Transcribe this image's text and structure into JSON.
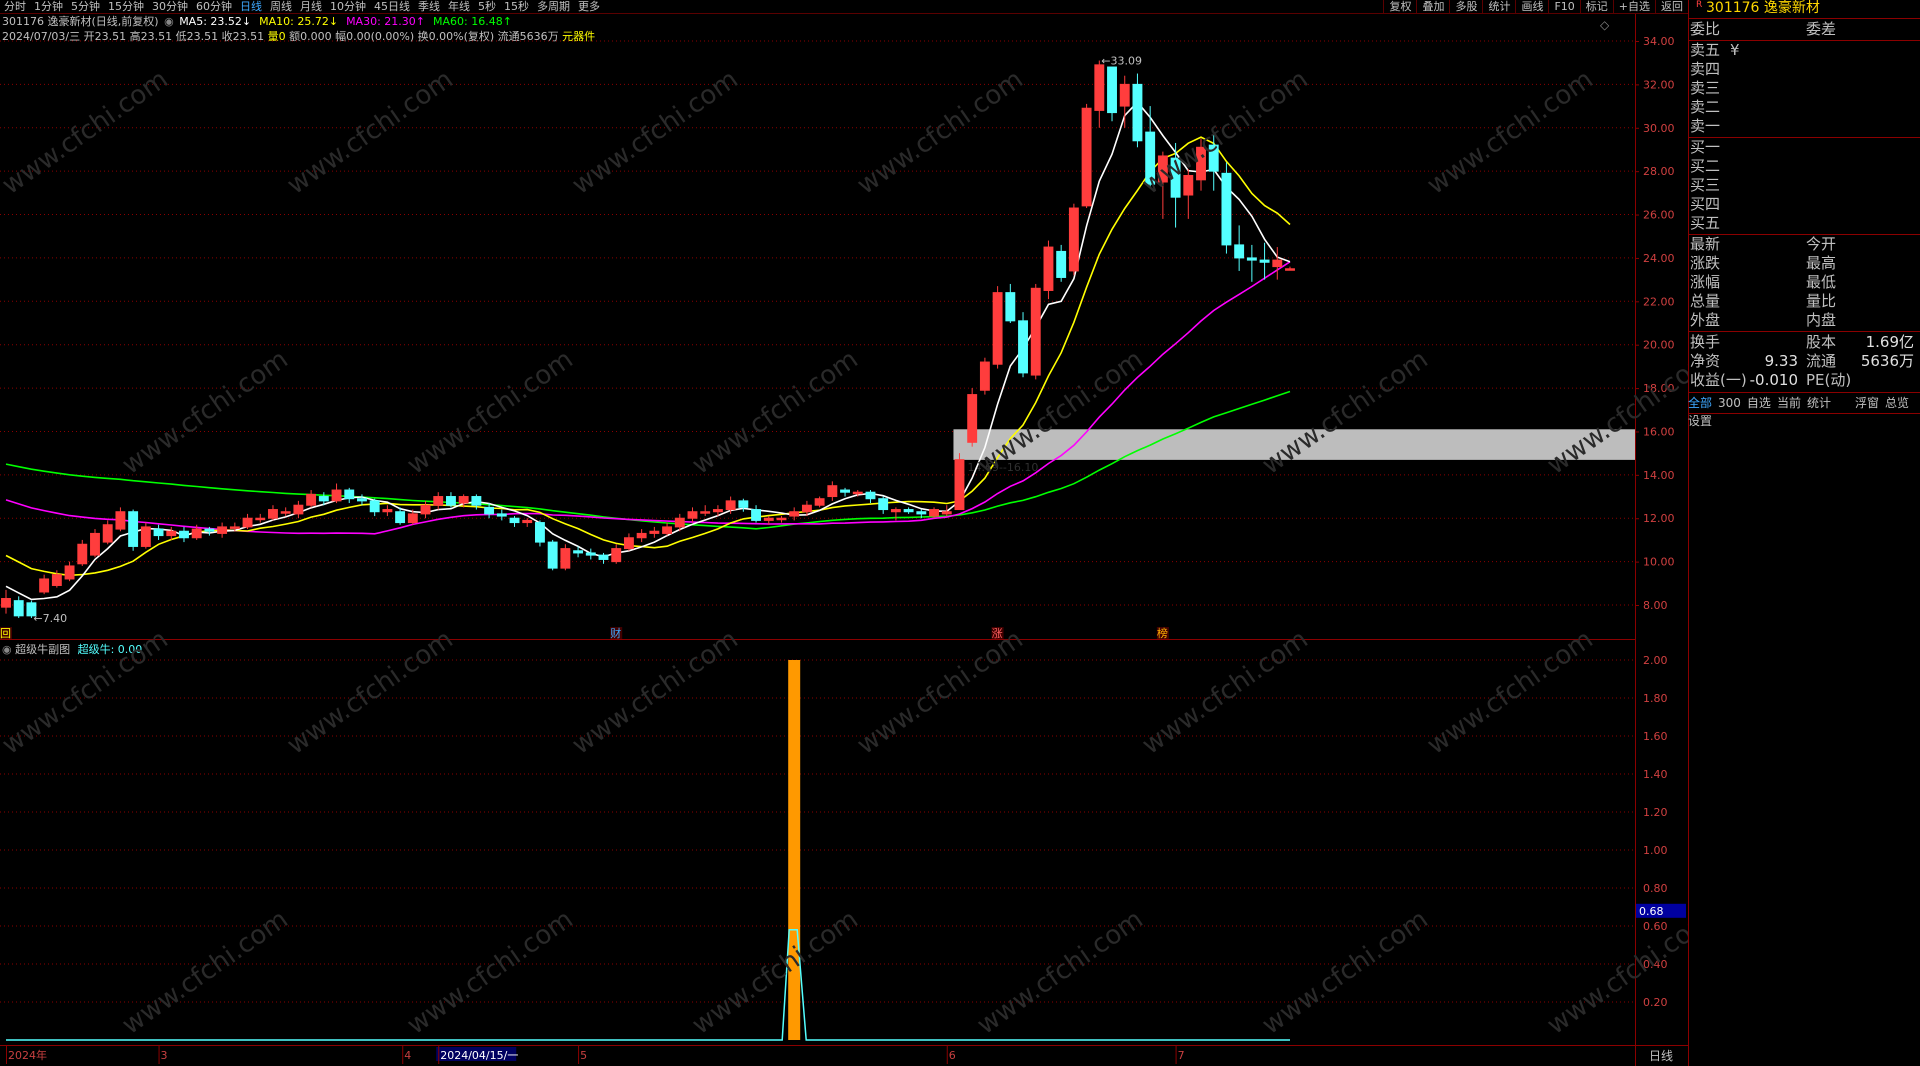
{
  "toolbar": {
    "periods": [
      "分时",
      "1分钟",
      "5分钟",
      "15分钟",
      "30分钟",
      "60分钟",
      "日线",
      "周线",
      "月线",
      "10分钟",
      "45日线",
      "季线",
      "年线",
      "5秒",
      "15秒",
      "多周期",
      "更多"
    ],
    "active": "日线",
    "right": [
      "复权",
      "叠加",
      "多股",
      "统计",
      "画线",
      "F10",
      "标记",
      "+自选",
      "返回"
    ]
  },
  "stock": {
    "code": "301176",
    "name": "逸豪新材",
    "header": "301176 逸豪新材(日线,前复权)",
    "corner_mark": "R"
  },
  "ma_legend": [
    {
      "label": "MA5: 23.52↓",
      "color": "#ffffff"
    },
    {
      "label": "MA10: 25.72↓",
      "color": "#ffff00"
    },
    {
      "label": "MA30: 21.30↑",
      "color": "#ff00ff"
    },
    {
      "label": "MA60: 16.48↑",
      "color": "#00ff00"
    }
  ],
  "quote_line": {
    "date": "2024/07/03/三",
    "open": "开23.51",
    "high": "高23.51",
    "low": "低23.51",
    "close": "收23.51",
    "vol": "量0",
    "amount": "额0.000",
    "change": "幅0.00(0.00%)",
    "turnover": "换0.00%(复权)",
    "float": "流通5636万",
    "tool": "元器件"
  },
  "indicator": {
    "name": "超级牛副图",
    "value_label": "超级牛: 0.00"
  },
  "price_axis": [
    "34.00",
    "32.00",
    "30.00",
    "28.00",
    "26.00",
    "24.00",
    "22.00",
    "20.00",
    "18.00",
    "16.00",
    "14.00",
    "12.00",
    "10.00",
    "8.00"
  ],
  "sub_axis": [
    "2.00",
    "1.80",
    "1.60",
    "1.40",
    "1.20",
    "1.00",
    "0.80",
    "0.60",
    "0.40",
    "0.20"
  ],
  "sub_marker": "0.68",
  "time_axis": {
    "labels": [
      "2024年",
      "3",
      "4",
      "2024/04/15/一",
      "5",
      "6",
      "7"
    ],
    "period": "日线"
  },
  "annotations": {
    "high": "33.09",
    "low": "7.40",
    "zone": "14.69--16.10",
    "events": [
      "回",
      "财",
      "涨",
      "榜"
    ]
  },
  "colors": {
    "up": "#ff3d3d",
    "down": "#54ffff",
    "ma5": "#ffffff",
    "ma10": "#ffff00",
    "ma30": "#ff00ff",
    "ma60": "#00ff00",
    "grid": "#8b0000",
    "bar": "#ff9900",
    "title": "#ffd700"
  },
  "panel": {
    "header": {
      "left": "委比",
      "right": "委差"
    },
    "sells": [
      "卖五",
      "卖四",
      "卖三",
      "卖二",
      "卖一"
    ],
    "buys": [
      "买一",
      "买二",
      "买三",
      "买四",
      "买五"
    ],
    "yen": "¥",
    "stats": [
      {
        "l": "最新",
        "m": "今开",
        "r": ""
      },
      {
        "l": "涨跌",
        "m": "最高",
        "r": ""
      },
      {
        "l": "涨幅",
        "m": "最低",
        "r": ""
      },
      {
        "l": "总量",
        "m": "量比",
        "r": ""
      },
      {
        "l": "外盘",
        "m": "内盘",
        "r": ""
      }
    ],
    "stats2": [
      {
        "l": "换手",
        "mv": "",
        "m": "股本",
        "r": "1.69亿"
      },
      {
        "l": "净资",
        "mv": "9.33",
        "m": "流通",
        "r": "5636万"
      },
      {
        "l": "收益(一)",
        "mv": "-0.010",
        "m": "PE(动)",
        "r": ""
      }
    ],
    "tabs": [
      "全部",
      "300",
      "自选",
      "当前",
      "统计",
      "浮窗",
      "总览",
      "设置"
    ]
  },
  "watermark": "www.cfchi.com",
  "chart_data": {
    "type": "candlestick",
    "candles": [
      [
        7.9,
        8.3,
        7.6,
        8.7
      ],
      [
        8.2,
        7.5,
        7.4,
        8.4
      ],
      [
        8.1,
        7.5,
        7.4,
        8.2
      ],
      [
        8.6,
        9.2,
        8.5,
        9.4
      ],
      [
        8.9,
        9.4,
        8.8,
        9.6
      ],
      [
        9.2,
        9.8,
        9.1,
        10.0
      ],
      [
        9.9,
        10.8,
        9.8,
        11.0
      ],
      [
        10.3,
        11.3,
        10.2,
        11.5
      ],
      [
        10.9,
        11.7,
        10.8,
        11.9
      ],
      [
        11.5,
        12.3,
        11.4,
        12.5
      ],
      [
        12.3,
        10.7,
        10.5,
        12.4
      ],
      [
        10.7,
        11.6,
        10.6,
        11.8
      ],
      [
        11.5,
        11.2,
        11.0,
        11.7
      ],
      [
        11.2,
        11.4,
        11.0,
        11.6
      ],
      [
        11.4,
        11.1,
        10.9,
        11.6
      ],
      [
        11.1,
        11.5,
        11.0,
        11.7
      ],
      [
        11.5,
        11.4,
        11.2,
        11.6
      ],
      [
        11.3,
        11.6,
        11.1,
        11.8
      ],
      [
        11.6,
        11.6,
        11.4,
        11.8
      ],
      [
        11.6,
        12.0,
        11.5,
        12.2
      ],
      [
        12.0,
        12.0,
        11.8,
        12.2
      ],
      [
        12.0,
        12.4,
        11.9,
        12.6
      ],
      [
        12.3,
        12.3,
        12.1,
        12.5
      ],
      [
        12.2,
        12.6,
        12.0,
        12.8
      ],
      [
        12.6,
        13.1,
        12.5,
        13.3
      ],
      [
        13.0,
        12.8,
        12.6,
        13.2
      ],
      [
        12.8,
        13.3,
        12.7,
        13.6
      ],
      [
        13.3,
        12.9,
        12.7,
        13.4
      ],
      [
        12.9,
        12.8,
        12.6,
        13.1
      ],
      [
        12.8,
        12.3,
        12.1,
        12.9
      ],
      [
        12.3,
        12.4,
        12.1,
        12.6
      ],
      [
        12.3,
        11.8,
        11.7,
        12.5
      ],
      [
        11.8,
        12.2,
        11.7,
        12.4
      ],
      [
        12.2,
        12.6,
        12.0,
        12.8
      ],
      [
        12.6,
        13.0,
        12.4,
        13.2
      ],
      [
        13.0,
        12.6,
        12.5,
        13.2
      ],
      [
        12.7,
        13.0,
        12.5,
        13.1
      ],
      [
        13.0,
        12.6,
        12.4,
        13.1
      ],
      [
        12.5,
        12.2,
        12.0,
        12.7
      ],
      [
        12.2,
        12.1,
        11.9,
        12.4
      ],
      [
        12.0,
        11.8,
        11.6,
        12.1
      ],
      [
        11.8,
        11.9,
        11.6,
        12.0
      ],
      [
        11.8,
        10.9,
        10.7,
        11.9
      ],
      [
        10.9,
        9.7,
        9.6,
        11.0
      ],
      [
        9.7,
        10.6,
        9.6,
        10.8
      ],
      [
        10.5,
        10.4,
        10.2,
        10.7
      ],
      [
        10.4,
        10.3,
        10.1,
        10.6
      ],
      [
        10.3,
        10.1,
        9.9,
        10.4
      ],
      [
        10.0,
        10.6,
        9.9,
        10.8
      ],
      [
        10.6,
        11.1,
        10.5,
        11.3
      ],
      [
        11.1,
        11.3,
        10.9,
        11.5
      ],
      [
        11.3,
        11.4,
        11.1,
        11.6
      ],
      [
        11.3,
        11.6,
        11.2,
        11.8
      ],
      [
        11.6,
        12.0,
        11.4,
        12.2
      ],
      [
        12.0,
        12.3,
        11.8,
        12.5
      ],
      [
        12.3,
        12.3,
        12.1,
        12.6
      ],
      [
        12.3,
        12.4,
        12.1,
        12.6
      ],
      [
        12.4,
        12.8,
        12.2,
        13.0
      ],
      [
        12.8,
        12.5,
        12.3,
        12.9
      ],
      [
        12.4,
        11.9,
        11.8,
        12.6
      ],
      [
        11.9,
        12.0,
        11.7,
        12.1
      ],
      [
        12.0,
        12.0,
        11.8,
        12.1
      ],
      [
        12.1,
        12.3,
        11.9,
        12.5
      ],
      [
        12.3,
        12.6,
        12.1,
        12.8
      ],
      [
        12.6,
        12.9,
        12.5,
        13.0
      ],
      [
        13.0,
        13.5,
        12.8,
        13.7
      ],
      [
        13.3,
        13.2,
        13.0,
        13.4
      ],
      [
        13.2,
        13.2,
        13.0,
        13.3
      ],
      [
        13.2,
        12.9,
        12.7,
        13.3
      ],
      [
        12.9,
        12.4,
        12.2,
        13.0
      ],
      [
        12.3,
        12.4,
        11.9,
        12.5
      ],
      [
        12.4,
        12.3,
        12.2,
        12.5
      ],
      [
        12.3,
        12.2,
        12.0,
        12.4
      ],
      [
        12.1,
        12.4,
        12.0,
        12.5
      ],
      [
        12.2,
        12.3,
        12.1,
        12.6
      ],
      [
        12.4,
        14.7,
        12.4,
        15.0
      ],
      [
        15.5,
        17.7,
        15.3,
        18.0
      ],
      [
        17.9,
        19.2,
        17.7,
        19.4
      ],
      [
        19.1,
        22.4,
        18.9,
        22.7
      ],
      [
        22.4,
        21.1,
        21.0,
        22.8
      ],
      [
        21.1,
        18.7,
        18.5,
        21.5
      ],
      [
        18.6,
        22.6,
        18.4,
        22.8
      ],
      [
        22.5,
        24.5,
        22.1,
        24.8
      ],
      [
        24.3,
        23.1,
        22.9,
        24.6
      ],
      [
        23.4,
        26.3,
        23.2,
        26.5
      ],
      [
        26.4,
        30.9,
        26.3,
        31.1
      ],
      [
        30.8,
        32.9,
        30.0,
        33.1
      ],
      [
        32.8,
        30.7,
        30.3,
        32.8
      ],
      [
        31.0,
        32.0,
        30.0,
        32.4
      ],
      [
        32.0,
        29.4,
        29.1,
        32.5
      ],
      [
        29.8,
        27.4,
        27.2,
        31.0
      ],
      [
        27.5,
        28.7,
        25.8,
        28.9
      ],
      [
        28.6,
        26.8,
        25.4,
        29.3
      ],
      [
        26.9,
        27.8,
        25.8,
        28.1
      ],
      [
        27.6,
        29.1,
        27.1,
        29.5
      ],
      [
        29.2,
        28.0,
        27.1,
        29.7
      ],
      [
        27.9,
        24.6,
        24.2,
        28.4
      ],
      [
        24.6,
        24.0,
        23.4,
        25.5
      ],
      [
        24.0,
        23.9,
        22.9,
        24.6
      ],
      [
        23.9,
        23.8,
        23.0,
        24.7
      ],
      [
        23.6,
        23.9,
        23.0,
        24.5
      ],
      [
        23.5,
        23.5,
        23.5,
        23.6
      ]
    ],
    "events_index": {
      "回": 0,
      "财": 48,
      "涨": 78,
      "榜": 91
    },
    "zone": [
      14.69,
      16.1
    ],
    "zone_start_index": 75,
    "indicator_spike_index": 62,
    "indicator_spike_value": 2.0,
    "indicator_baseline": 0,
    "sub_line_peak": 0.58,
    "ylim": [
      7,
      35
    ],
    "sub_ylim": [
      0,
      2.1
    ]
  }
}
